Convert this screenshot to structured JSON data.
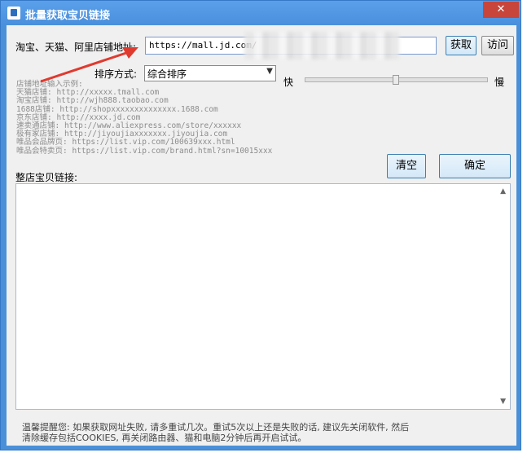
{
  "window": {
    "title": "批量获取宝贝链接",
    "close_label": "✕"
  },
  "form": {
    "url_label": "淘宝、天猫、阿里店铺地址:",
    "url_value": "https://mall.jd.com/",
    "fetch_label": "获取",
    "visit_label": "访问",
    "sort_label": "排序方式:",
    "sort_selected": "综合排序",
    "speed_fast_label": "快",
    "speed_slow_label": "慢",
    "speed_level": 0.5
  },
  "examples": [
    "店铺地址输入示例:",
    "天猫店铺: http://xxxxx.tmall.com",
    "淘宝店铺: http://wjh888.taobao.com",
    "1688店铺: http://shopxxxxxxxxxxxxxx.1688.com",
    "京东店铺: http://xxxx.jd.com",
    "速卖通店铺: http://www.aliexpress.com/store/xxxxxx",
    "极有家店铺: http://jiyoujiaxxxxxxx.jiyoujia.com",
    "唯品会品牌页: https://list.vip.com/100639xxx.html",
    "唯品会特卖页: https://list.vip.com/brand.html?sn=10015xxx"
  ],
  "actions": {
    "clear_label": "清空",
    "confirm_label": "确定"
  },
  "results": {
    "label": "整店宝贝链接:"
  },
  "notice": {
    "line1": "温馨提醒您: 如果获取网址失败, 请多重试几次。重试5次以上还是失败的话, 建议先关闭软件, 然后",
    "line2": "清除缓存包括COOKIES, 再关闭路由器、猫和电脑2分钟后再开启试试。"
  },
  "colors": {
    "titlebar": "#4a8fdc",
    "close": "#c7453a",
    "annotation_arrow": "#e03a2f"
  }
}
